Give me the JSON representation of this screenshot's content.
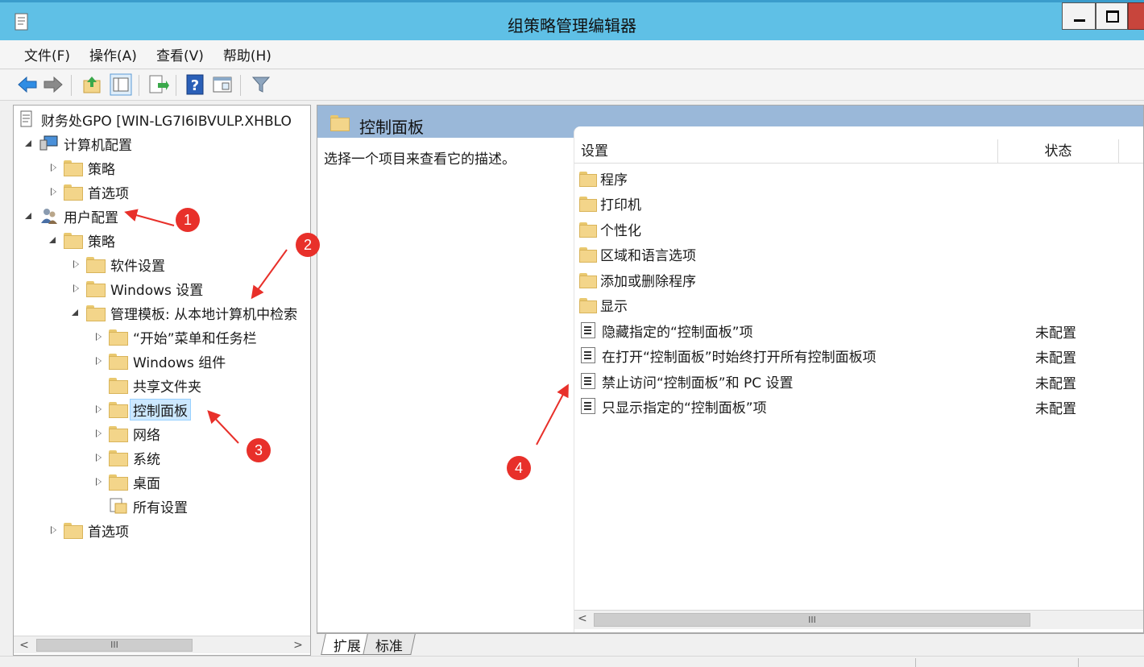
{
  "window": {
    "title": "组策略管理编辑器"
  },
  "menu": [
    "文件(F)",
    "操作(A)",
    "查看(V)",
    "帮助(H)"
  ],
  "tree": {
    "root": "财务处GPO [WIN-LG7I6IBVULP.XHBLO",
    "computer_config": "计算机配置",
    "computer_policy": "策略",
    "computer_prefs": "首选项",
    "user_config": "用户配置",
    "user_policy": "策略",
    "software_settings": "软件设置",
    "windows_settings": "Windows 设置",
    "admin_templates": "管理模板: 从本地计算机中检索",
    "start_menu": "“开始”菜单和任务栏",
    "windows_components": "Windows 组件",
    "shared_folders": "共享文件夹",
    "control_panel": "控制面板",
    "network": "网络",
    "system": "系统",
    "desktop": "桌面",
    "all_settings": "所有设置",
    "user_prefs": "首选项"
  },
  "right": {
    "header": "控制面板",
    "description": "选择一个项目来查看它的描述。",
    "col_setting": "设置",
    "col_state": "状态",
    "folders": [
      "程序",
      "打印机",
      "个性化",
      "区域和语言选项",
      "添加或删除程序",
      "显示"
    ],
    "settings": [
      {
        "name": "隐藏指定的“控制面板”项",
        "state": "未配置"
      },
      {
        "name": "在打开“控制面板”时始终打开所有控制面板项",
        "state": "未配置"
      },
      {
        "name": "禁止访问“控制面板”和 PC 设置",
        "state": "未配置"
      },
      {
        "name": "只显示指定的“控制面板”项",
        "state": "未配置"
      }
    ]
  },
  "tabs": [
    "扩展",
    "标准"
  ],
  "annotations": [
    "1",
    "2",
    "3",
    "4"
  ],
  "colors": {
    "titlebar": "#5fc0e6",
    "header": "#9ab8d9",
    "annotation": "#e8302a"
  }
}
